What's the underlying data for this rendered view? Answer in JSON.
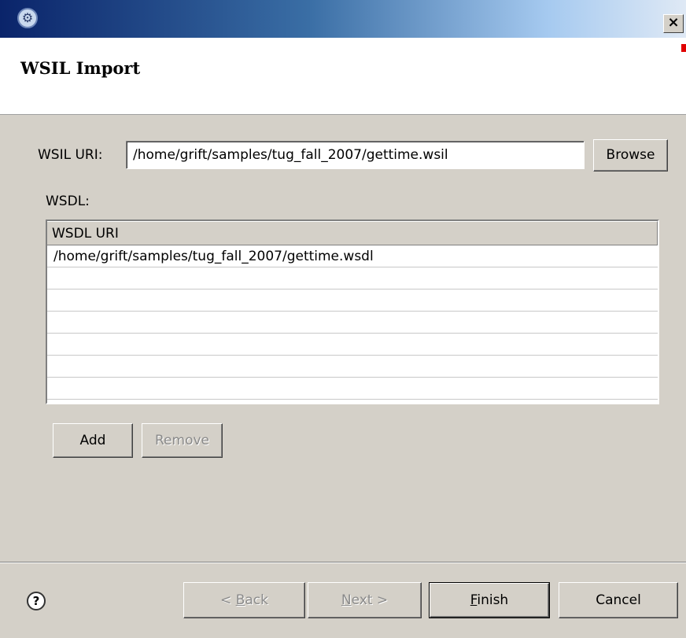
{
  "window": {
    "close_label": "×"
  },
  "header": {
    "title": "WSIL Import"
  },
  "wsil": {
    "label": "WSIL URI:",
    "value": "/home/grift/samples/tug_fall_2007/gettime.wsil",
    "browse_label": "Browse"
  },
  "wsdl": {
    "label": "WSDL:",
    "column_header": "WSDL URI",
    "rows": [
      "/home/grift/samples/tug_fall_2007/gettime.wsdl",
      "",
      "",
      "",
      "",
      "",
      ""
    ],
    "add_label": "Add",
    "remove_label": "Remove"
  },
  "footer": {
    "back_prefix": "< ",
    "back_mnemonic": "B",
    "back_rest": "ack",
    "next_mnemonic": "N",
    "next_rest": "ext >",
    "finish_mnemonic": "F",
    "finish_rest": "inish",
    "cancel_label": "Cancel"
  },
  "icons": {
    "app": "gear-icon",
    "help": "help-icon",
    "close": "close-icon"
  }
}
